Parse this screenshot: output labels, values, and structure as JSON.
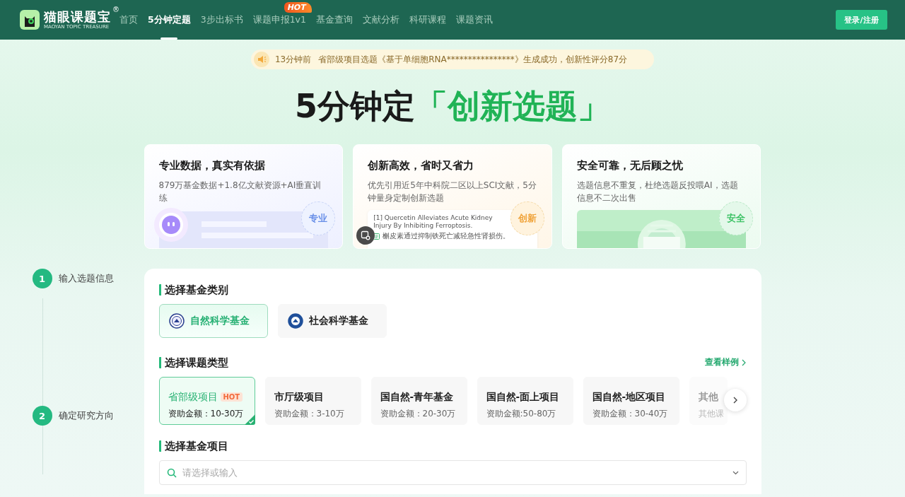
{
  "header": {
    "logo": {
      "name": "猫眼课题宝",
      "mark": "®",
      "sub": "MAOYAN TOPIC TREASURE"
    },
    "nav": [
      {
        "label": "首页",
        "selected": false
      },
      {
        "label": "5分钟定题",
        "selected": true
      },
      {
        "label": "3步出标书",
        "selected": false
      },
      {
        "label": "课题申报1v1",
        "selected": false,
        "badge": "HOT"
      },
      {
        "label": "基金查询",
        "selected": false
      },
      {
        "label": "文献分析",
        "selected": false
      },
      {
        "label": "科研课程",
        "selected": false
      },
      {
        "label": "课题资讯",
        "selected": false
      }
    ],
    "login": "登录/注册"
  },
  "notice": {
    "time": "13分钟前",
    "text": "省部级项目选题《基于单细胞RNA****************》生成成功，创新性评分87分"
  },
  "hero": {
    "title": "5分钟定",
    "highlight": "「创新选题」"
  },
  "features": [
    {
      "kind": "robot",
      "title": "专业数据，真实有依据",
      "desc": "879万基金数据+1.8亿文献资源+AI垂直训练",
      "badge": "专业"
    },
    {
      "kind": "citation",
      "title": "创新高效，省时又省力",
      "desc": "优先引用近5年中科院二区以上SCI文献，5分钟量身定制创新选题",
      "badge": "创新",
      "citation": {
        "en": "[1] Quercetin Alleviates Acute Kidney Injury By Inhibiting Ferroptosis.",
        "zh": "槲皮素通过抑制铁死亡减轻急性肾损伤。"
      }
    },
    {
      "kind": "certificate",
      "title": "安全可靠，无后顾之忧",
      "desc": "选题信息不重复，杜绝选题反投喂AI，选题信息不二次出售",
      "badge": "安全"
    }
  ],
  "steps": [
    {
      "number": "1",
      "label": "输入选题信息"
    },
    {
      "number": "2",
      "label": "确定研究方向"
    }
  ],
  "fund_category": {
    "heading": "选择基金类别",
    "options": [
      {
        "label": "自然科学基金",
        "selected": true
      },
      {
        "label": "社会科学基金",
        "selected": false
      }
    ]
  },
  "topic_type": {
    "heading": "选择课题类型",
    "link": "查看样例",
    "options": [
      {
        "title": "省部级项目",
        "tag": "HOT",
        "amount": "资助金额：10-30万",
        "selected": true,
        "faded": false
      },
      {
        "title": "市厅级项目",
        "amount": "资助金额：3-10万",
        "selected": false,
        "faded": false
      },
      {
        "title": "国自然-青年基金",
        "amount": "资助金额：20-30万",
        "selected": false,
        "faded": false
      },
      {
        "title": "国自然-面上项目",
        "amount": "资助金额:50-80万",
        "selected": false,
        "faded": false
      },
      {
        "title": "国自然-地区项目",
        "amount": "资助金额：30-40万",
        "selected": false,
        "faded": false
      },
      {
        "title": "其他",
        "amount": "其他课",
        "selected": false,
        "faded": true
      }
    ]
  },
  "fund_project": {
    "heading": "选择基金项目",
    "placeholder": "请选择或输入"
  }
}
